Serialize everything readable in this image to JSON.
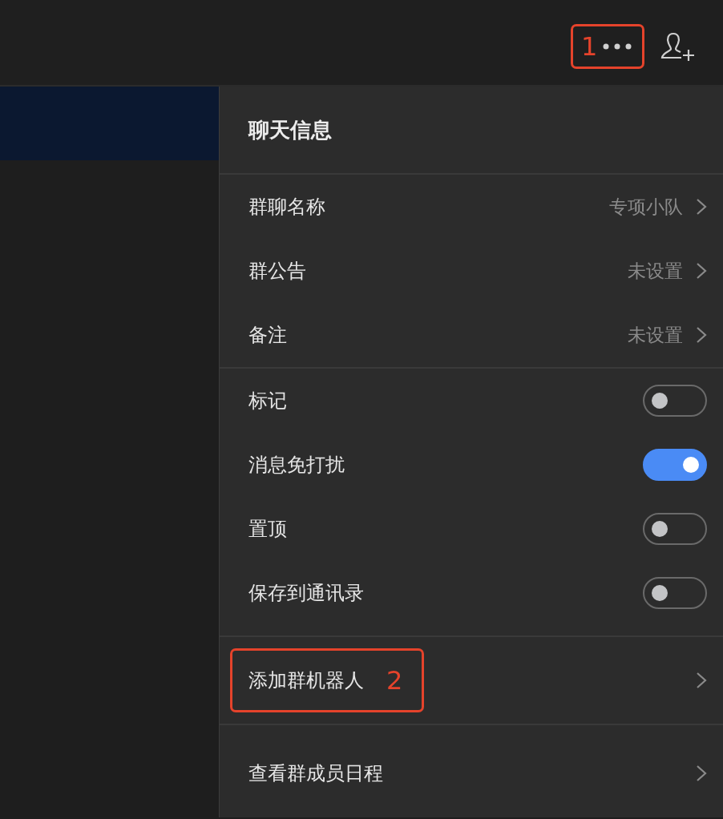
{
  "top_bar": {
    "more_button": {
      "annotation": "1"
    }
  },
  "panel": {
    "title": "聊天信息",
    "sections": [
      {
        "rows": [
          {
            "kind": "link",
            "label": "群聊名称",
            "value": "专项小队"
          },
          {
            "kind": "link",
            "label": "群公告",
            "value": "未设置"
          },
          {
            "kind": "link",
            "label": "备注",
            "value": "未设置"
          }
        ]
      },
      {
        "rows": [
          {
            "kind": "toggle",
            "label": "标记",
            "on": false
          },
          {
            "kind": "toggle",
            "label": "消息免打扰",
            "on": true
          },
          {
            "kind": "toggle",
            "label": "置顶",
            "on": false
          },
          {
            "kind": "toggle",
            "label": "保存到通讯录",
            "on": false
          }
        ]
      },
      {
        "rows": [
          {
            "kind": "link",
            "label": "添加群机器人",
            "annotation": "2"
          }
        ]
      },
      {
        "rows": [
          {
            "kind": "link",
            "label": "查看群成员日程"
          }
        ]
      }
    ]
  }
}
